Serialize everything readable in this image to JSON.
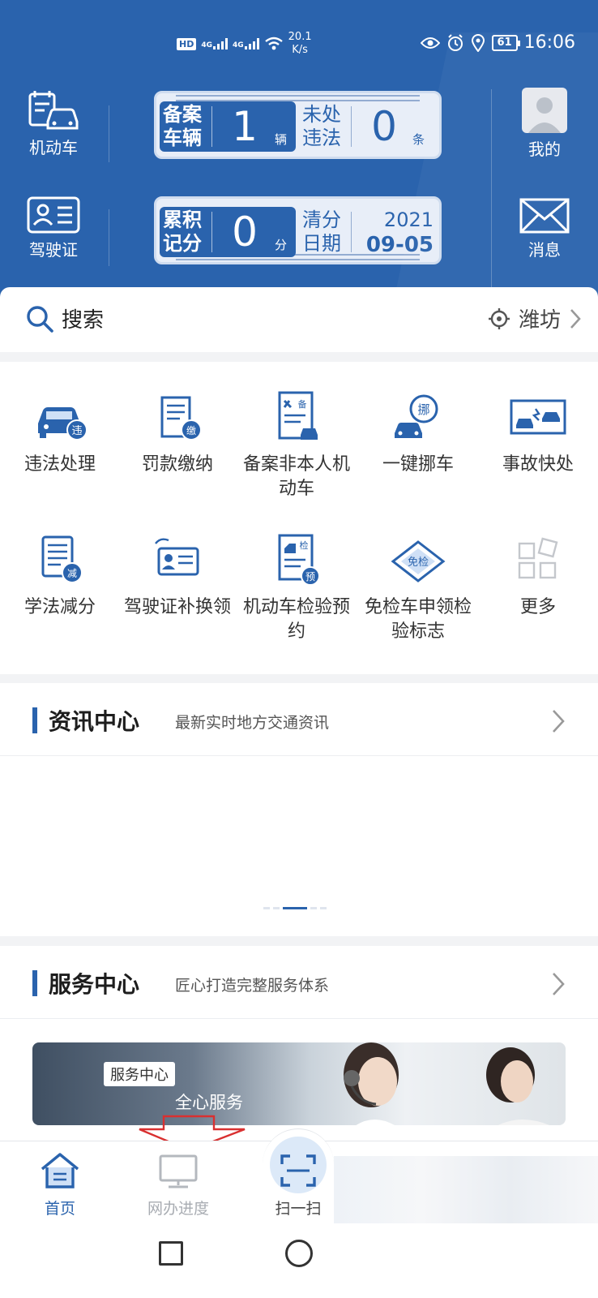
{
  "status_bar": {
    "hd": "HD",
    "net1": "4G",
    "net2": "4G",
    "speed_value": "20.1",
    "speed_unit": "K/s",
    "battery": "61",
    "time": "16:06"
  },
  "header": {
    "vehicle_label": "机动车",
    "license_label": "驾驶证",
    "mine_label": "我的",
    "message_label": "消息",
    "card1": {
      "left_label": "备案\n车辆",
      "left_value": "1",
      "left_unit": "辆",
      "right_label": "未处\n违法",
      "right_value": "0",
      "right_unit": "条"
    },
    "card2": {
      "left_label": "累积\n记分",
      "left_value": "0",
      "left_unit": "分",
      "right_label": "清分\n日期",
      "year": "2021",
      "month_day": "09-05"
    }
  },
  "search": {
    "label": "搜索",
    "city": "潍坊"
  },
  "services": [
    {
      "label": "违法处理",
      "icon": "car-violation-icon"
    },
    {
      "label": "罚款缴纳",
      "icon": "fine-payment-icon"
    },
    {
      "label": "备案非本人机动车",
      "icon": "register-vehicle-icon"
    },
    {
      "label": "一键挪车",
      "icon": "move-car-icon"
    },
    {
      "label": "事故快处",
      "icon": "accident-icon"
    },
    {
      "label": "学法减分",
      "icon": "study-reduce-icon"
    },
    {
      "label": "驾驶证补换领",
      "icon": "license-renew-icon"
    },
    {
      "label": "机动车检验预约",
      "icon": "inspection-booking-icon"
    },
    {
      "label": "免检车申领检验标志",
      "icon": "exempt-label-icon"
    },
    {
      "label": "更多",
      "icon": "more-grid-icon"
    }
  ],
  "news": {
    "title": "资讯中心",
    "subtitle": "最新实时地方交通资讯"
  },
  "service_center": {
    "title": "服务中心",
    "subtitle": "匠心打造完整服务体系",
    "banner_tag": "服务中心",
    "banner_slogan": "全心服务"
  },
  "tabbar": {
    "home": "首页",
    "progress": "网办进度",
    "scan": "扫一扫"
  },
  "colors": {
    "primary": "#2a63ad",
    "card_bg": "#e8eef8"
  }
}
